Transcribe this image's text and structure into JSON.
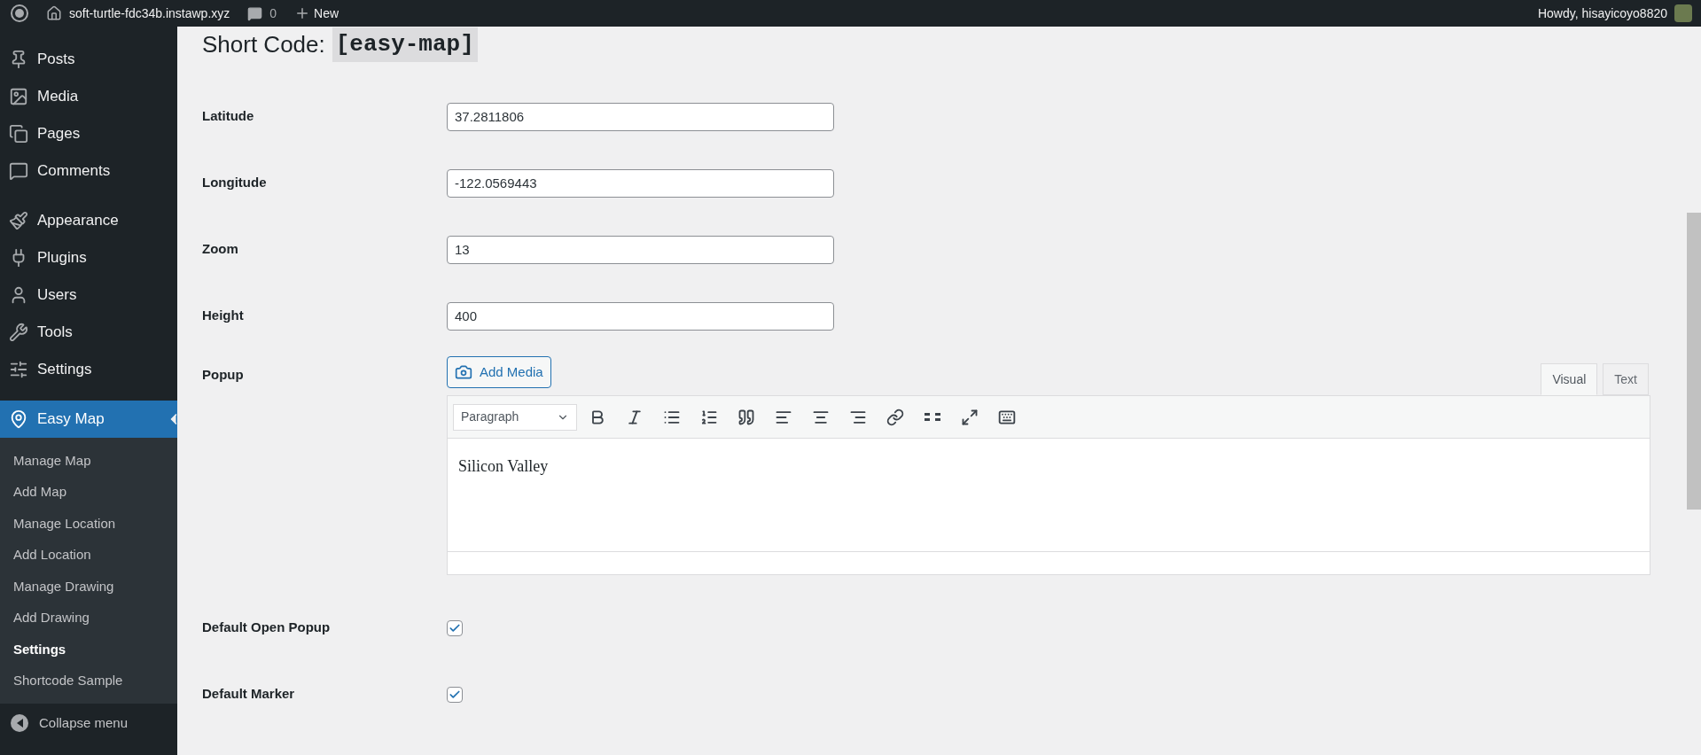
{
  "admin_bar": {
    "site": "soft-turtle-fdc34b.instawp.xyz",
    "comments": "0",
    "new": "New",
    "greeting": "Howdy, hisayicoyo8820"
  },
  "sidebar": {
    "groups": [
      [
        {
          "label": "Posts",
          "selected": false
        },
        {
          "label": "Media",
          "selected": false
        },
        {
          "label": "Pages",
          "selected": false
        },
        {
          "label": "Comments",
          "selected": false
        }
      ],
      [
        {
          "label": "Appearance",
          "selected": false
        },
        {
          "label": "Plugins",
          "selected": false
        },
        {
          "label": "Users",
          "selected": false
        },
        {
          "label": "Tools",
          "selected": false
        },
        {
          "label": "Settings",
          "selected": false
        }
      ],
      [
        {
          "label": "Easy Map",
          "selected": true
        }
      ]
    ],
    "submenu": [
      {
        "label": "Manage Map",
        "selected": false
      },
      {
        "label": "Add Map",
        "selected": false
      },
      {
        "label": "Manage Location",
        "selected": false
      },
      {
        "label": "Add Location",
        "selected": false
      },
      {
        "label": "Manage Drawing",
        "selected": false
      },
      {
        "label": "Add Drawing",
        "selected": false
      },
      {
        "label": "Settings",
        "selected": true
      },
      {
        "label": "Shortcode Sample",
        "selected": false
      }
    ],
    "collapse": "Collapse menu"
  },
  "short_code": {
    "label": "Short Code:",
    "code": "[easy-map]"
  },
  "fields": [
    {
      "kind": "text",
      "label": "Latitude",
      "value": "37.2811806"
    },
    {
      "kind": "text",
      "label": "Longitude",
      "value": "-122.0569443"
    },
    {
      "kind": "text",
      "label": "Zoom",
      "value": "13"
    },
    {
      "kind": "text",
      "label": "Height",
      "value": "400"
    },
    {
      "kind": "editor",
      "label": "Popup",
      "add_media": "Add Media",
      "tabs": [
        {
          "label": "Visual",
          "selected": true
        },
        {
          "label": "Text",
          "selected": false
        }
      ],
      "format": "Paragraph",
      "content": "Silicon Valley"
    },
    {
      "kind": "checkbox",
      "label": "Default Open Popup",
      "checked": true
    },
    {
      "kind": "checkbox",
      "label": "Default Marker",
      "checked": true
    }
  ]
}
